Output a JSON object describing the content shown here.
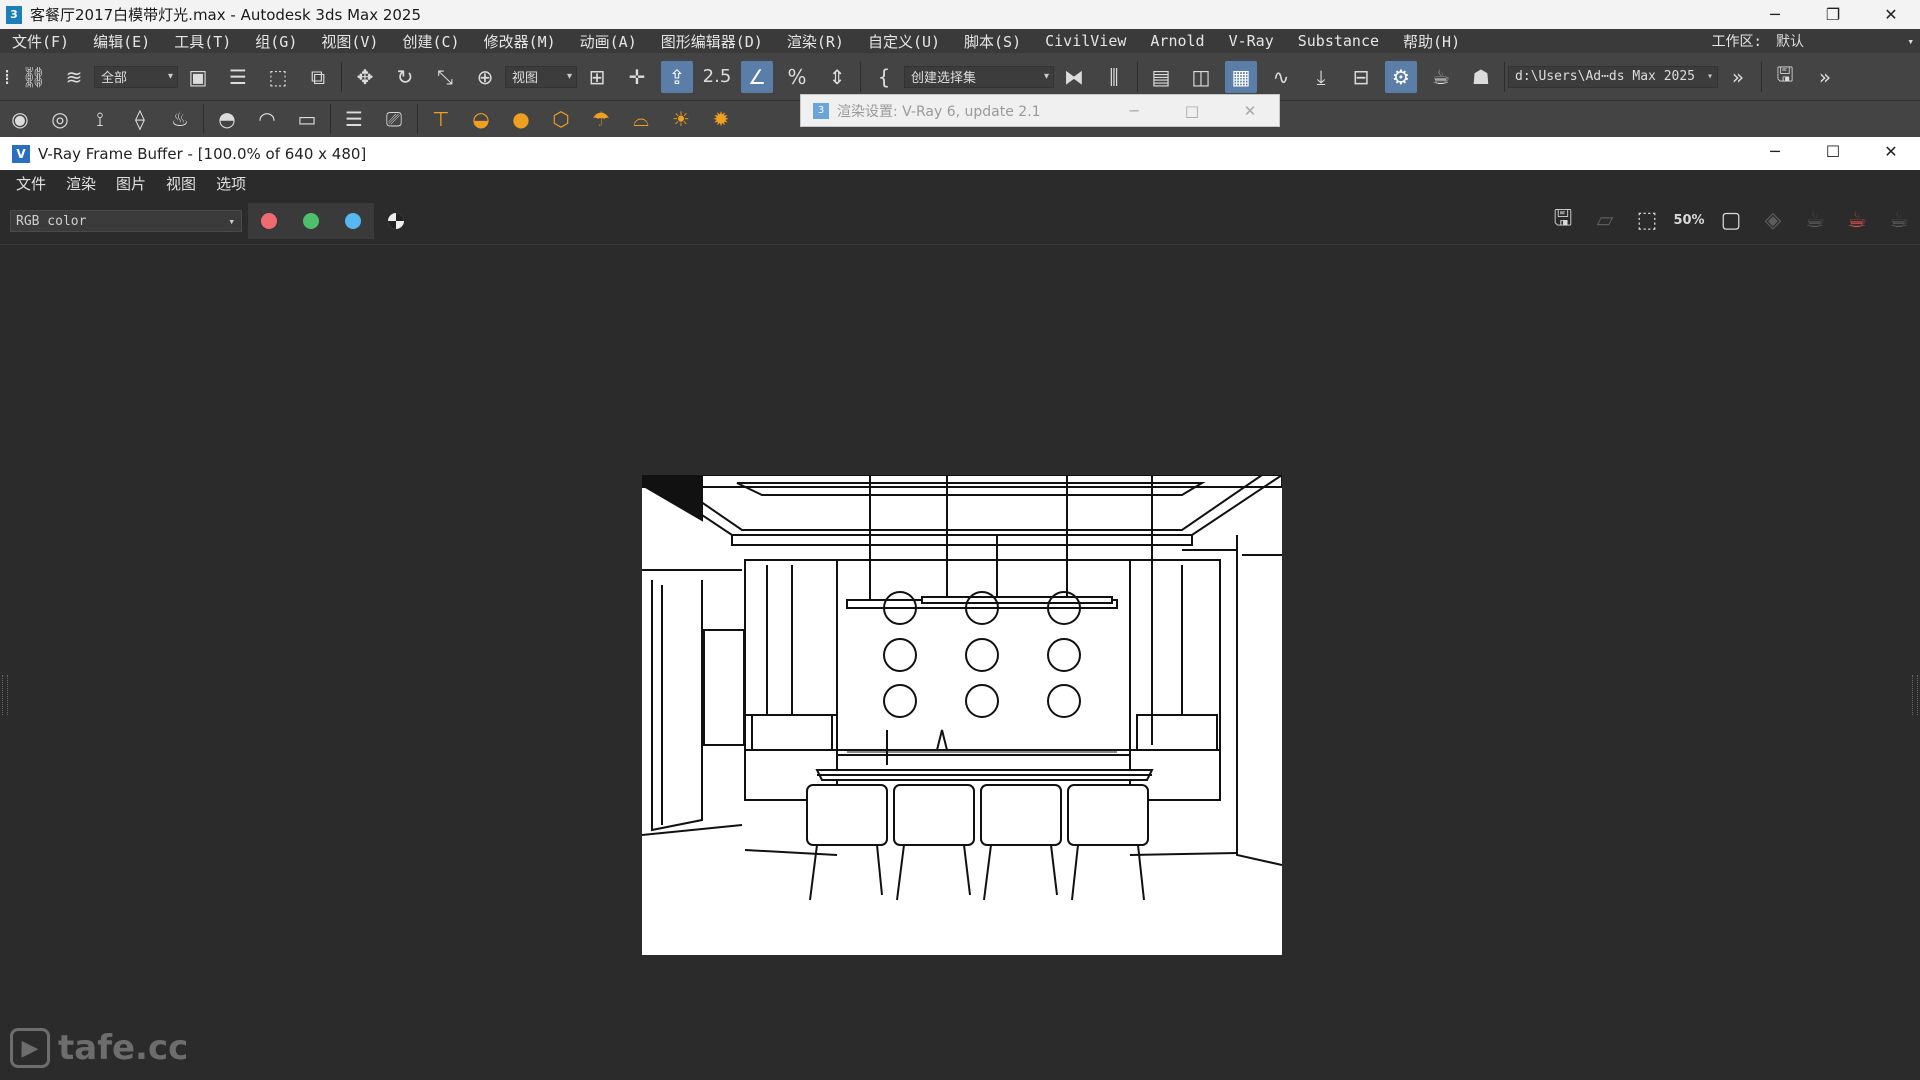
{
  "window": {
    "title": "客餐厅2017白模带灯光.max - Autodesk 3ds Max 2025",
    "app_icon_glyph": "3"
  },
  "menu": {
    "items": [
      "文件(F)",
      "编辑(E)",
      "工具(T)",
      "组(G)",
      "视图(V)",
      "创建(C)",
      "修改器(M)",
      "动画(A)",
      "图形编辑器(D)",
      "渲染(R)",
      "自定义(U)",
      "脚本(S)",
      "CivilView",
      "Arnold",
      "V-Ray",
      "Substance",
      "帮助(H)"
    ],
    "workspace_label": "工作区:",
    "workspace_value": "默认"
  },
  "toolbar1": {
    "selection_filter": "全部",
    "ref_coord": "视图",
    "named_selection": "创建选择集",
    "project_path": "d:\\Users\\Ad⋯ds Max 2025",
    "snap_number": "2.5"
  },
  "render_dialog": {
    "title": "渲染设置: V-Ray 6, update 2.1",
    "icon_glyph": "3"
  },
  "vfb": {
    "title": "V-Ray Frame Buffer - [100.0% of 640 x 480]",
    "menu": [
      "文件",
      "渲染",
      "图片",
      "视图",
      "选项"
    ],
    "channel": "RGB color",
    "zoom_label": "50%",
    "colors": {
      "red": "#f06a73",
      "green": "#4cc06a",
      "blue": "#55b8f0"
    }
  },
  "watermark": {
    "text": "tafe.cc"
  },
  "colors": {
    "background": "#2b2b2b",
    "toolbar": "#444444",
    "active_tool": "#5b7ea8"
  }
}
